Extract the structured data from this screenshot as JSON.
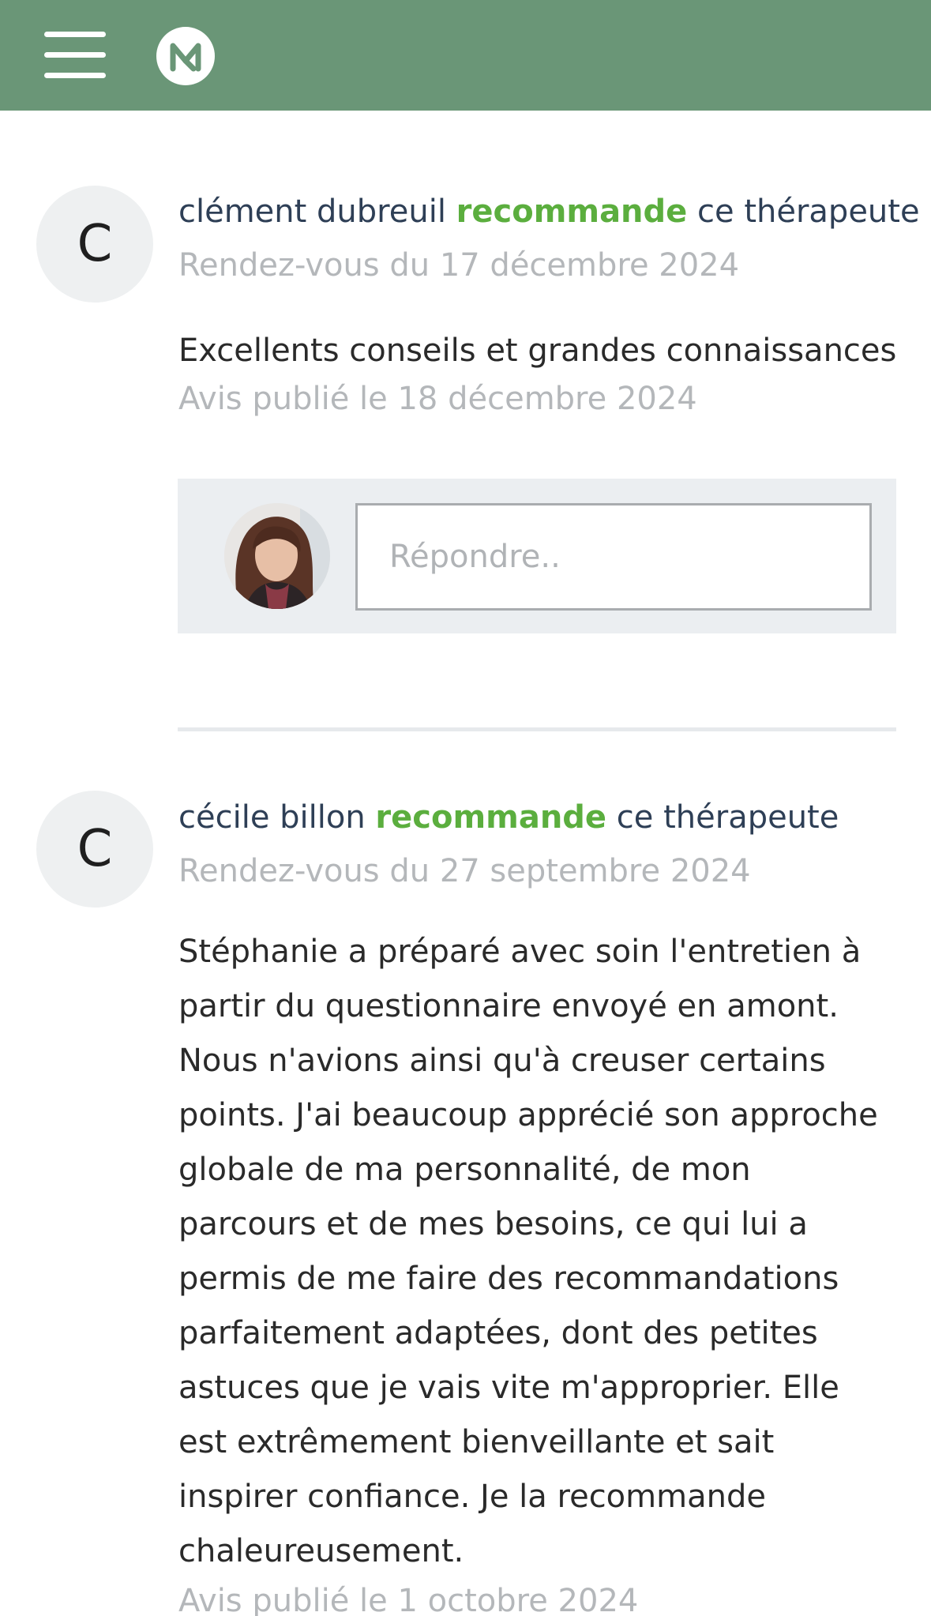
{
  "header": {
    "menu_icon": "hamburger-menu-icon",
    "logo_icon": "m-logo-icon",
    "brand_color": "#6a9677"
  },
  "reviews": [
    {
      "initial": "C",
      "author": "clément dubreuil",
      "verb": "recommande",
      "suffix": "ce thérapeute",
      "appointment": "Rendez-vous du 17 décembre 2024",
      "text": "Excellents conseils et grandes connaissances",
      "published": "Avis publié le 18 décembre 2024",
      "reply_placeholder": "Répondre.."
    },
    {
      "initial": "C",
      "author": "cécile billon",
      "verb": "recommande",
      "suffix": "ce thérapeute",
      "appointment": "Rendez-vous du 27 septembre 2024",
      "text": "Stéphanie a préparé avec soin l'entretien à partir du questionnaire envoyé en amont. Nous n'avions ainsi qu'à creuser certains points. J'ai beaucoup apprécié son approche globale de ma personnalité, de mon parcours et de mes besoins, ce qui lui a permis de me faire des recommandations parfaitement adaptées, dont des petites astuces que je vais vite m'approprier. Elle est extrêmement bienveillante et sait inspirer confiance. Je la recommande chaleureusement.",
      "published": "Avis publié le 1 octobre 2024"
    }
  ],
  "colors": {
    "recommend_green": "#5bae3e",
    "author_navy": "#2e3f56",
    "muted_gray": "#b4b7ba"
  }
}
